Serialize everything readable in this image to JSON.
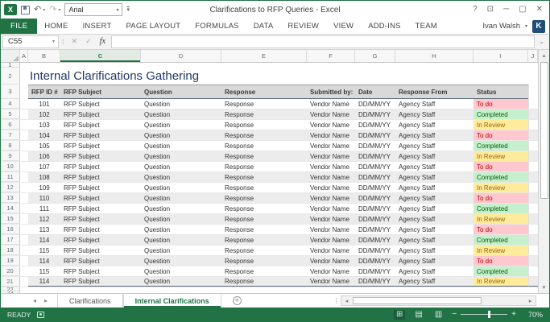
{
  "window": {
    "title": "Clarifications to RFP Queries - Excel",
    "qat_font_name": "Arial",
    "user_name": "Ivan Walsh",
    "user_initial": "K",
    "excel_logo": "X"
  },
  "icons": {
    "undo": "↶",
    "redo": "↷",
    "dropdown": "▾",
    "help": "?",
    "ribbon_options": "⊡",
    "minimize": "─",
    "maximize": "▢",
    "close": "✕",
    "cancel": "✕",
    "enter": "✓",
    "fx": "fx",
    "chevron_down": "⌄",
    "dots": "⁞",
    "prev": "◂",
    "next": "▸",
    "up": "▴",
    "down": "▾",
    "left": "◂",
    "right": "▸",
    "new_sheet": "+",
    "normal_view": "⊞",
    "page_layout": "▤",
    "page_break": "▥",
    "zoom_out": "−",
    "zoom_in": "+"
  },
  "ribbon": {
    "file_label": "FILE",
    "tabs": [
      "HOME",
      "INSERT",
      "PAGE LAYOUT",
      "FORMULAS",
      "DATA",
      "REVIEW",
      "VIEW",
      "ADD-INS",
      "TEAM"
    ]
  },
  "formula_bar": {
    "name_box": "C55",
    "formula": ""
  },
  "grid": {
    "columns": [
      "A",
      "B",
      "C",
      "D",
      "E",
      "F",
      "G",
      "H",
      "I",
      "J"
    ],
    "selected_column": "C",
    "first_row": 1,
    "last_row": 23
  },
  "sheet": {
    "title": "Internal Clarifications Gathering",
    "headers": [
      "RFP ID #",
      "RFP Subject",
      "Question",
      "Response",
      "Submitted by:",
      "Date",
      "Response From",
      "Status"
    ],
    "rows": [
      {
        "id": "101",
        "subject": "RFP Subject",
        "question": "Question",
        "response": "Response",
        "submitted_by": "Vendor Name",
        "date": "DD/MM/YY",
        "response_from": "Agency Staff",
        "status": "To do"
      },
      {
        "id": "102",
        "subject": "RFP Subject",
        "question": "Question",
        "response": "Response",
        "submitted_by": "Vendor Name",
        "date": "DD/MM/YY",
        "response_from": "Agency Staff",
        "status": "Completed"
      },
      {
        "id": "103",
        "subject": "RFP Subject",
        "question": "Question",
        "response": "Response",
        "submitted_by": "Vendor Name",
        "date": "DD/MM/YY",
        "response_from": "Agency Staff",
        "status": "In Review"
      },
      {
        "id": "104",
        "subject": "RFP Subject",
        "question": "Question",
        "response": "Response",
        "submitted_by": "Vendor Name",
        "date": "DD/MM/YY",
        "response_from": "Agency Staff",
        "status": "To do"
      },
      {
        "id": "105",
        "subject": "RFP Subject",
        "question": "Question",
        "response": "Response",
        "submitted_by": "Vendor Name",
        "date": "DD/MM/YY",
        "response_from": "Agency Staff",
        "status": "Completed"
      },
      {
        "id": "106",
        "subject": "RFP Subject",
        "question": "Question",
        "response": "Response",
        "submitted_by": "Vendor Name",
        "date": "DD/MM/YY",
        "response_from": "Agency Staff",
        "status": "In Review"
      },
      {
        "id": "107",
        "subject": "RFP Subject",
        "question": "Question",
        "response": "Response",
        "submitted_by": "Vendor Name",
        "date": "DD/MM/YY",
        "response_from": "Agency Staff",
        "status": "To do"
      },
      {
        "id": "108",
        "subject": "RFP Subject",
        "question": "Question",
        "response": "Response",
        "submitted_by": "Vendor Name",
        "date": "DD/MM/YY",
        "response_from": "Agency Staff",
        "status": "Completed"
      },
      {
        "id": "109",
        "subject": "RFP Subject",
        "question": "Question",
        "response": "Response",
        "submitted_by": "Vendor Name",
        "date": "DD/MM/YY",
        "response_from": "Agency Staff",
        "status": "In Review"
      },
      {
        "id": "110",
        "subject": "RFP Subject",
        "question": "Question",
        "response": "Response",
        "submitted_by": "Vendor Name",
        "date": "DD/MM/YY",
        "response_from": "Agency Staff",
        "status": "To do"
      },
      {
        "id": "111",
        "subject": "RFP Subject",
        "question": "Question",
        "response": "Response",
        "submitted_by": "Vendor Name",
        "date": "DD/MM/YY",
        "response_from": "Agency Staff",
        "status": "Completed"
      },
      {
        "id": "112",
        "subject": "RFP Subject",
        "question": "Question",
        "response": "Response",
        "submitted_by": "Vendor Name",
        "date": "DD/MM/YY",
        "response_from": "Agency Staff",
        "status": "In Review"
      },
      {
        "id": "113",
        "subject": "RFP Subject",
        "question": "Question",
        "response": "Response",
        "submitted_by": "Vendor Name",
        "date": "DD/MM/YY",
        "response_from": "Agency Staff",
        "status": "To do"
      },
      {
        "id": "114",
        "subject": "RFP Subject",
        "question": "Question",
        "response": "Response",
        "submitted_by": "Vendor Name",
        "date": "DD/MM/YY",
        "response_from": "Agency Staff",
        "status": "Completed"
      },
      {
        "id": "115",
        "subject": "RFP Subject",
        "question": "Question",
        "response": "Response",
        "submitted_by": "Vendor Name",
        "date": "DD/MM/YY",
        "response_from": "Agency Staff",
        "status": "In Review"
      },
      {
        "id": "114",
        "subject": "RFP Subject",
        "question": "Question",
        "response": "Response",
        "submitted_by": "Vendor Name",
        "date": "DD/MM/YY",
        "response_from": "Agency Staff",
        "status": "To do"
      },
      {
        "id": "115",
        "subject": "RFP Subject",
        "question": "Question",
        "response": "Response",
        "submitted_by": "Vendor Name",
        "date": "DD/MM/YY",
        "response_from": "Agency Staff",
        "status": "Completed"
      },
      {
        "id": "114",
        "subject": "RFP Subject",
        "question": "Question",
        "response": "Response",
        "submitted_by": "Vendor Name",
        "date": "DD/MM/YY",
        "response_from": "Agency Staff",
        "status": "In Review"
      }
    ]
  },
  "status_colors": {
    "To do": {
      "bg": "#ffc7ce",
      "fg": "#c00000"
    },
    "Completed": {
      "bg": "#c6efce",
      "fg": "#006100"
    },
    "In Review": {
      "bg": "#ffeb9c",
      "fg": "#9c6500"
    }
  },
  "tabs_bar": {
    "sheets": [
      {
        "name": "Clarifications",
        "active": false
      },
      {
        "name": "Internal Clarifications",
        "active": true
      }
    ]
  },
  "status_bar": {
    "mode": "READY",
    "zoom": "70%"
  },
  "colors": {
    "excel_green": "#217346",
    "title_blue": "#1f3864"
  }
}
